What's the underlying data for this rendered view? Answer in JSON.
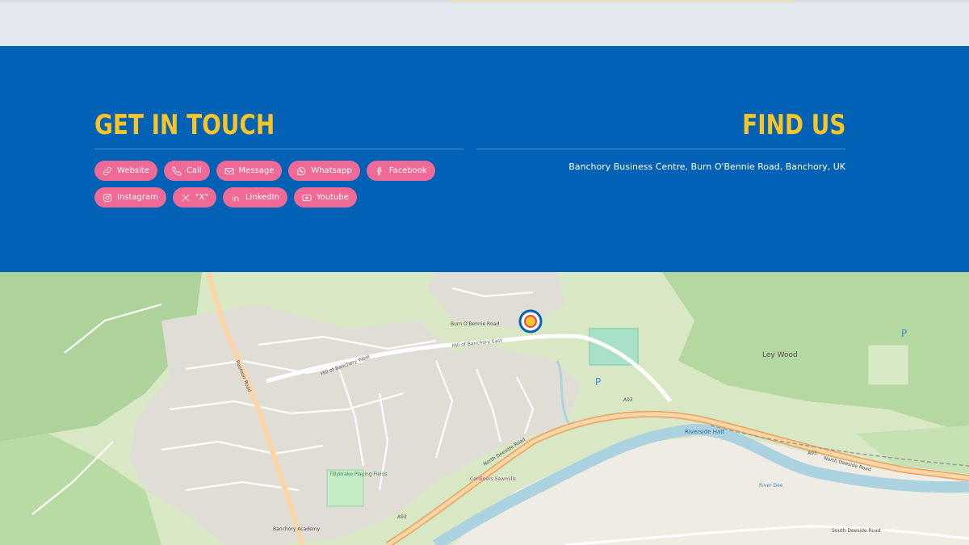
{
  "contact": {
    "heading": "GET IN TOUCH",
    "buttons": [
      {
        "label": "Website",
        "icon": "link-icon"
      },
      {
        "label": "Call",
        "icon": "phone-icon"
      },
      {
        "label": "Message",
        "icon": "mail-icon"
      },
      {
        "label": "Whatsapp",
        "icon": "whatsapp-icon"
      },
      {
        "label": "Facebook",
        "icon": "facebook-icon"
      },
      {
        "label": "Instagram",
        "icon": "instagram-icon"
      },
      {
        "label": "\"X\"",
        "icon": "x-icon"
      },
      {
        "label": "LinkedIn",
        "icon": "linkedin-icon"
      },
      {
        "label": "Youtube",
        "icon": "youtube-icon"
      }
    ]
  },
  "find_us": {
    "heading": "FIND US",
    "address": "Banchory Business Centre, Burn O'Bennie Road, Banchory, UK"
  },
  "map": {
    "labels": {
      "ley_wood": "Ley Wood",
      "riverside_halt": "Riverside Halt",
      "a93_a": "A93",
      "a93_b": "A93",
      "a93_c": "A93",
      "north_deeside_road": "North Deeside Road",
      "north_deeside_road_east": "North Deeside Road",
      "hill_of_banchory_west": "Hill of Banchory West",
      "hill_of_banchory_east": "Hill of Banchory East",
      "raemoir_road": "Raemoir Road",
      "tillybrake": "Tillybrake Playing Fields",
      "south_deeside_road": "South Deeside Road",
      "river_dee": "River Dee",
      "banchory_academy": "Banchory Academy",
      "cordiners_sawmills": "Cordiners Sawmills",
      "burn_obennie_road": "Burn O'Bennie Road",
      "parking": "P"
    },
    "colors": {
      "brand_blue": "#0061b5",
      "accent_yellow": "#f9c428",
      "pill_pink": "#ef6a97"
    }
  }
}
